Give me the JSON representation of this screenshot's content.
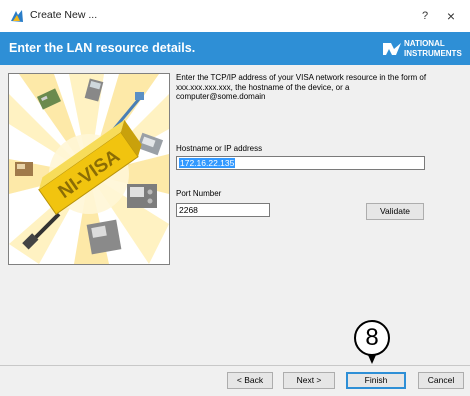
{
  "window": {
    "title": "Create New ...",
    "help_symbol": "?",
    "close_symbol": "×"
  },
  "header": {
    "title": "Enter the LAN resource details.",
    "logo_line1": "NATIONAL",
    "logo_line2": "INSTRUMENTS"
  },
  "illustration": {
    "label": "NI-VISA"
  },
  "form": {
    "instructions": "Enter the TCP/IP address of your VISA network resource in the form of xxx.xxx.xxx.xxx, the hostname of the device, or a computer@some.domain",
    "hostname_label": "Hostname or IP address",
    "hostname_value": "172.16.22.135",
    "port_label": "Port Number",
    "port_value": "2268",
    "validate_label": "Validate"
  },
  "buttons": {
    "back": "< Back",
    "next": "Next >",
    "finish": "Finish",
    "cancel": "Cancel"
  },
  "annotation": {
    "step_number": "8"
  },
  "colors": {
    "header_bg": "#2e8fd6",
    "selection": "#3399ff"
  }
}
